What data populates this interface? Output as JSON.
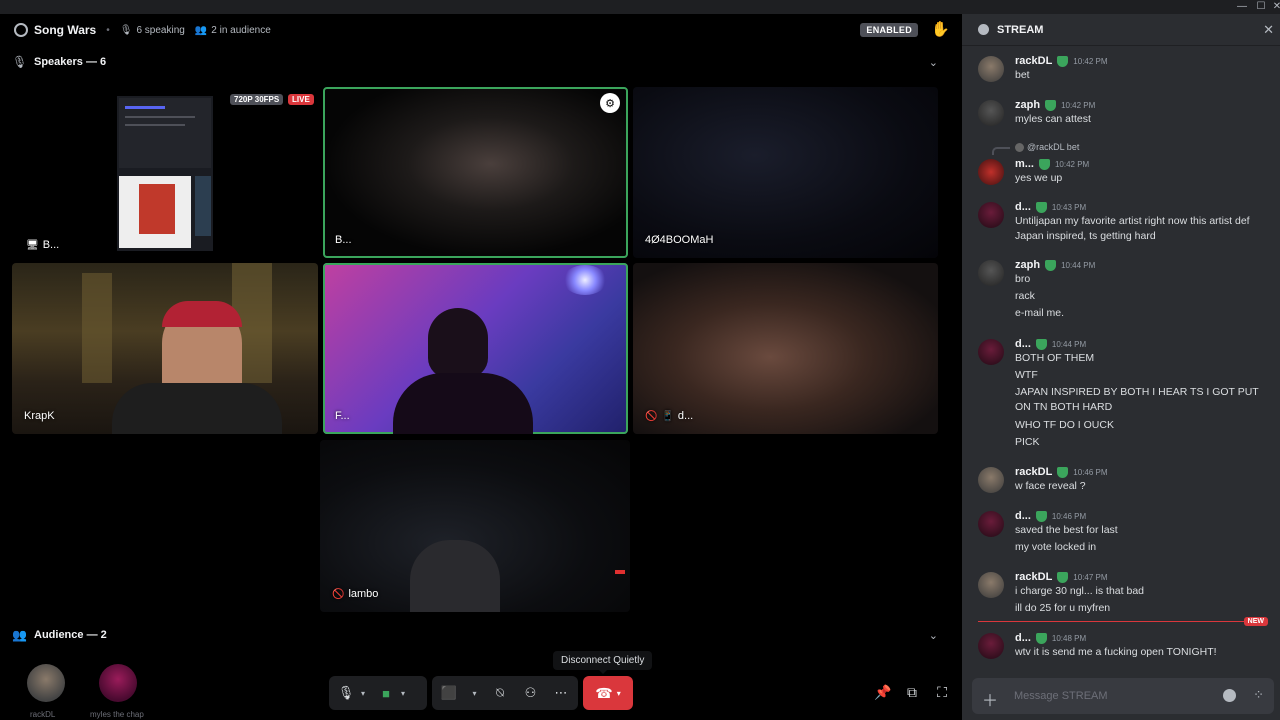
{
  "window_controls": [
    "—",
    "☐",
    "✕"
  ],
  "stage": {
    "channel_title": "Song Wars",
    "speaking_count": "6 speaking",
    "audience_count": "2 in audience",
    "enabled_label": "ENABLED",
    "speakers_label": "Speakers — 6",
    "audience_label": "Audience — 2"
  },
  "tiles": [
    {
      "name": "B...",
      "badge_res": "720P 30FPS",
      "badge_live": "LIVE"
    },
    {
      "name": "B..."
    },
    {
      "name": "4Ø4BOOMaH"
    },
    {
      "name": "KrapK"
    },
    {
      "name": "F..."
    },
    {
      "name": "d..."
    },
    {
      "name": "lambo"
    }
  ],
  "audience": [
    {
      "name": "rackDL"
    },
    {
      "name": "myles the chap"
    }
  ],
  "controls": {
    "disconnect_tooltip": "Disconnect Quietly"
  },
  "chat": {
    "title": "STREAM",
    "placeholder": "Message STREAM",
    "new_label": "NEW",
    "messages": [
      {
        "author": "rackDL",
        "time": "10:42 PM",
        "lines": [
          "bet"
        ]
      },
      {
        "author": "zaph",
        "time": "10:42 PM",
        "lines": [
          "myles can attest"
        ]
      },
      {
        "author": "m...",
        "time": "10:42 PM",
        "reply": "@rackDL  bet",
        "lines": [
          "yes we up"
        ]
      },
      {
        "author": "d...",
        "time": "10:43 PM",
        "lines": [
          "Untiljapan my favorite artist right now this artist def Japan inspired, ts getting hard"
        ]
      },
      {
        "author": "zaph",
        "time": "10:44 PM",
        "lines": [
          "bro",
          "rack",
          "e-mail me."
        ]
      },
      {
        "author": "d...",
        "time": "10:44 PM",
        "lines": [
          "BOTH OF THEM",
          "WTF",
          "JAPAN INSPIRED BY BOTH I HEAR TS I GOT PUT ON TN BOTH HARD",
          "WHO TF DO I OUCK",
          "PICK"
        ]
      },
      {
        "author": "rackDL",
        "time": "10:46 PM",
        "lines": [
          "w face reveal ?"
        ]
      },
      {
        "author": "d...",
        "time": "10:46 PM",
        "lines": [
          "saved the best for last",
          "my vote locked in"
        ]
      },
      {
        "author": "rackDL",
        "time": "10:47 PM",
        "lines": [
          "i charge 30 ngl... is  that bad",
          "ill do 25 for u myfren"
        ]
      },
      {
        "author": "d...",
        "time": "10:48 PM",
        "lines": [
          "wtv it is send me a fucking open TONIGHT!"
        ]
      }
    ]
  }
}
